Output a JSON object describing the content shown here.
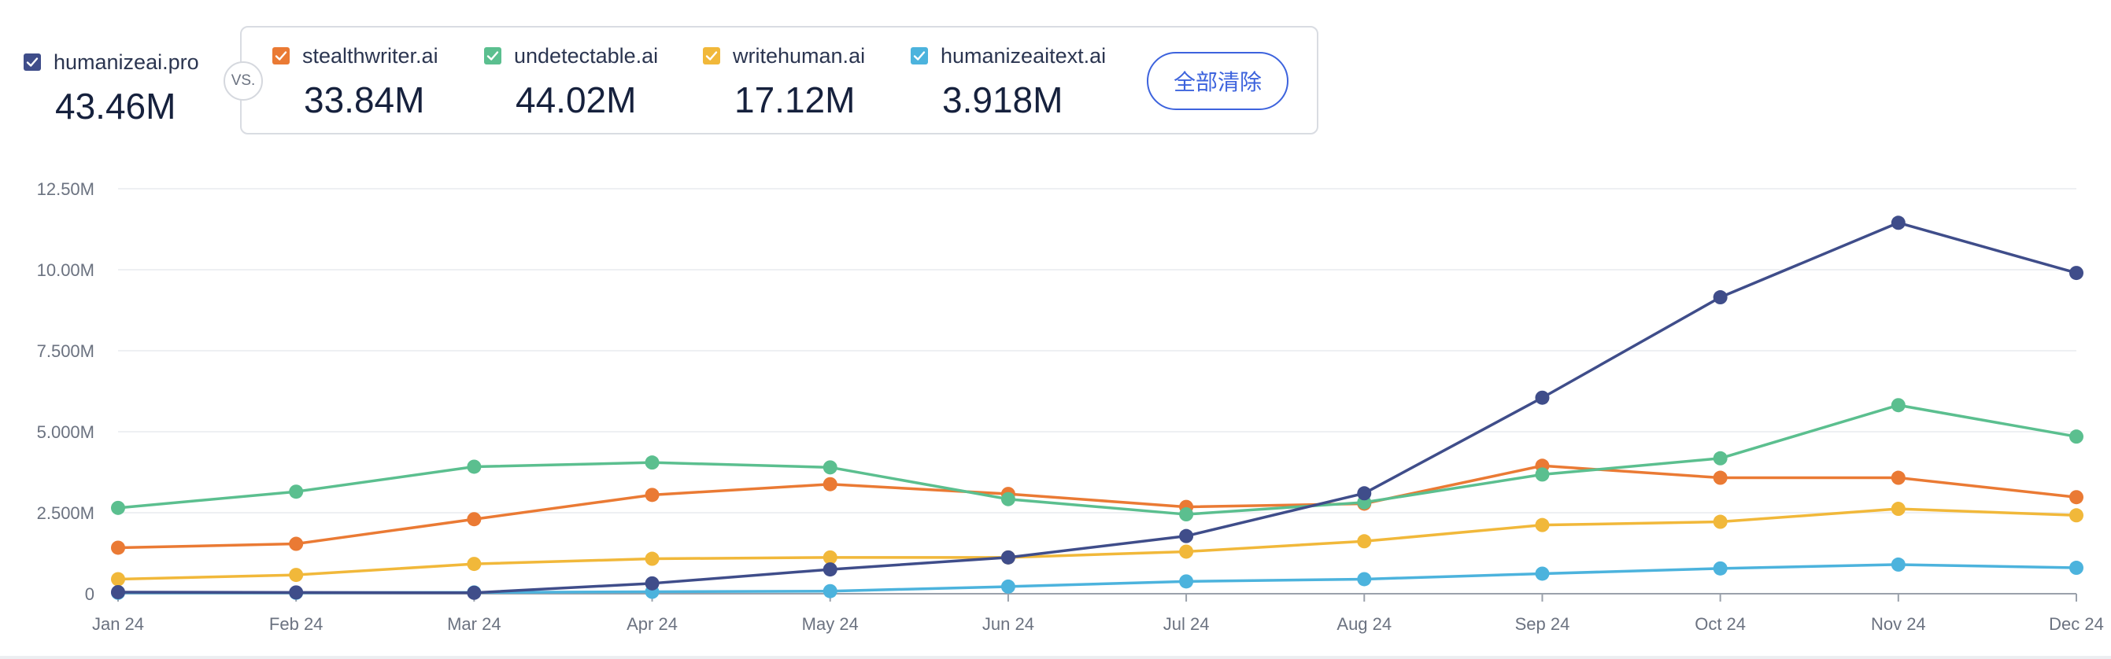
{
  "legend": {
    "primary": {
      "name": "humanizeai.pro",
      "value": "43.46M",
      "color": "#3f4d8a",
      "icon": "checkbox-checked-icon"
    },
    "vs_label": "VS.",
    "competitors": [
      {
        "name": "stealthwriter.ai",
        "value": "33.84M",
        "color": "#ea7a34",
        "icon": "checkbox-checked-icon"
      },
      {
        "name": "undetectable.ai",
        "value": "44.02M",
        "color": "#5bbf8f",
        "icon": "checkbox-checked-icon"
      },
      {
        "name": "writehuman.ai",
        "value": "17.12M",
        "color": "#f1b83a",
        "icon": "checkbox-checked-icon"
      },
      {
        "name": "humanizeaitext.ai",
        "value": "3.918M",
        "color": "#4cb3dd",
        "icon": "checkbox-checked-icon"
      }
    ],
    "clear_all_label": "全部清除"
  },
  "chart_data": {
    "type": "line",
    "categories": [
      "Jan 24",
      "Feb 24",
      "Mar 24",
      "Apr 24",
      "May 24",
      "Jun 24",
      "Jul 24",
      "Aug 24",
      "Sep 24",
      "Oct 24",
      "Nov 24",
      "Dec 24"
    ],
    "y_ticks": [
      {
        "value": 0,
        "label": "0"
      },
      {
        "value": 2.5,
        "label": "2.500M"
      },
      {
        "value": 5.0,
        "label": "5.000M"
      },
      {
        "value": 7.5,
        "label": "7.500M"
      },
      {
        "value": 10.0,
        "label": "10.00M"
      },
      {
        "value": 12.5,
        "label": "12.50M"
      }
    ],
    "ylim": [
      0,
      12.5
    ],
    "y_unit": "M",
    "grid": true,
    "series": [
      {
        "name": "humanizeai.pro",
        "color": "#3f4d8a",
        "values": [
          0.05,
          0.04,
          0.03,
          0.32,
          0.75,
          1.12,
          1.78,
          3.1,
          6.05,
          9.15,
          11.45,
          9.9
        ]
      },
      {
        "name": "stealthwriter.ai",
        "color": "#ea7a34",
        "values": [
          1.42,
          1.54,
          2.3,
          3.05,
          3.38,
          3.08,
          2.68,
          2.78,
          3.95,
          3.58,
          3.58,
          2.98
        ]
      },
      {
        "name": "undetectable.ai",
        "color": "#5bbf8f",
        "values": [
          2.65,
          3.15,
          3.92,
          4.05,
          3.9,
          2.92,
          2.45,
          2.82,
          3.68,
          4.18,
          5.82,
          4.85
        ]
      },
      {
        "name": "writehuman.ai",
        "color": "#f1b83a",
        "values": [
          0.45,
          0.58,
          0.92,
          1.08,
          1.12,
          1.12,
          1.3,
          1.62,
          2.12,
          2.22,
          2.62,
          2.42
        ]
      },
      {
        "name": "humanizeaitext.ai",
        "color": "#4cb3dd",
        "values": [
          0.03,
          0.03,
          0.04,
          0.06,
          0.08,
          0.22,
          0.38,
          0.45,
          0.62,
          0.78,
          0.9,
          0.8
        ]
      }
    ]
  }
}
